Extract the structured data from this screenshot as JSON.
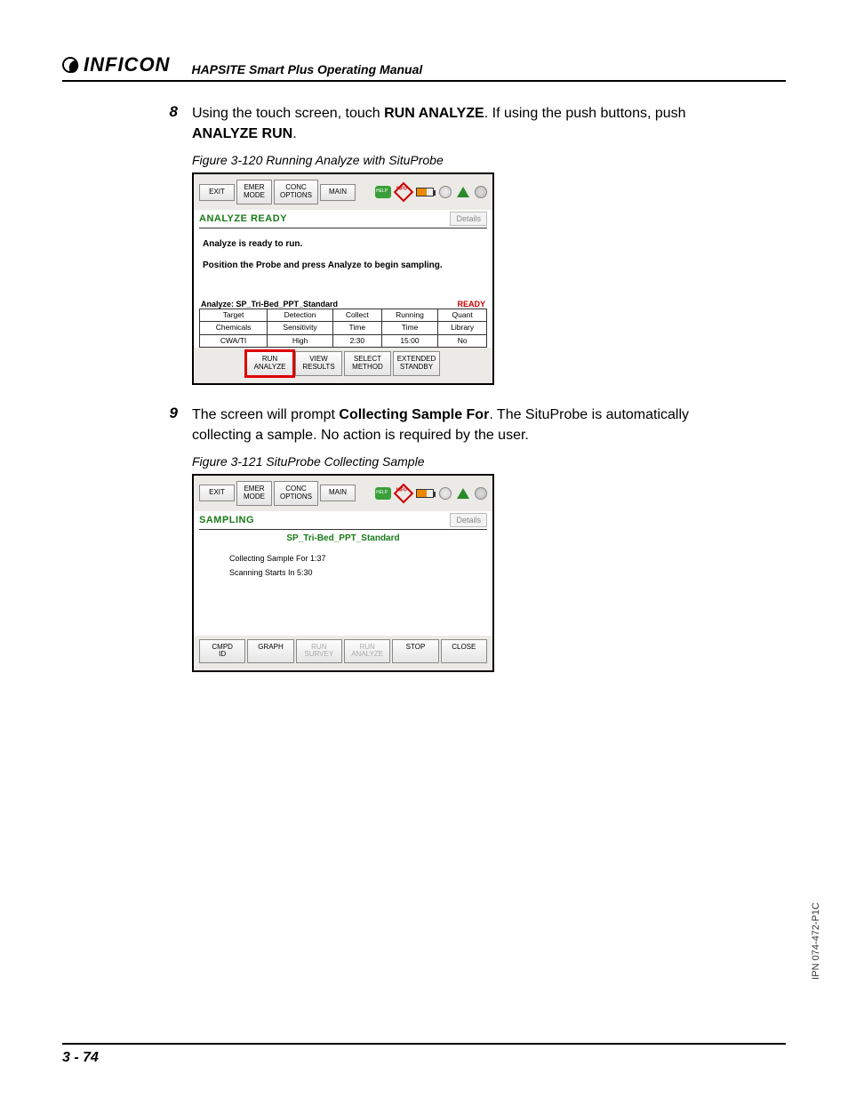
{
  "header": {
    "brand": "INFICON",
    "manual_title": "HAPSITE Smart Plus Operating Manual"
  },
  "step8": {
    "num": "8",
    "text_before": "Using the touch screen, touch ",
    "bold1": "RUN ANALYZE",
    "text_mid": ". If using the push buttons, push ",
    "bold2": "ANALYZE RUN",
    "text_after": "."
  },
  "fig120": {
    "caption": "Figure 3-120  Running Analyze with SituProbe",
    "toolbar": {
      "exit": "EXIT",
      "emer1": "EMER",
      "emer2": "MODE",
      "conc1": "CONC",
      "conc2": "OPTIONS",
      "main": "MAIN"
    },
    "status": "ANALYZE READY",
    "details": "Details",
    "msg1": "Analyze is ready to run.",
    "msg2": "Position the Probe and press Analyze to begin sampling.",
    "analyze_label": "Analyze: SP_Tri-Bed_PPT_Standard",
    "ready": "READY",
    "table": {
      "r1": [
        "Target",
        "Detection",
        "Collect",
        "Running",
        "Quant"
      ],
      "r2": [
        "Chemicals",
        "Sensitivity",
        "Time",
        "Time",
        "Library"
      ],
      "r3": [
        "CWA/TI",
        "High",
        "2:30",
        "15:00",
        "No"
      ]
    },
    "buttons": {
      "run1": "RUN",
      "run2": "ANALYZE",
      "view1": "VIEW",
      "view2": "RESULTS",
      "sel1": "SELECT",
      "sel2": "METHOD",
      "ext1": "EXTENDED",
      "ext2": "STANDBY"
    }
  },
  "step9": {
    "num": "9",
    "text_before": "The screen will prompt ",
    "bold1": "Collecting Sample For",
    "text_after1": ". The SituProbe is automatically collecting a sample. No action is required by the user."
  },
  "fig121": {
    "caption": "Figure 3-121  SituProbe Collecting Sample",
    "status": "SAMPLING",
    "details": "Details",
    "method": "SP_Tri-Bed_PPT_Standard",
    "line1": "Collecting Sample For  1:37",
    "line2": "Scanning Starts In  5:30",
    "buttons": {
      "cmpd1": "CMPD",
      "cmpd2": "ID",
      "graph": "GRAPH",
      "rsurv1": "RUN",
      "rsurv2": "SURVEY",
      "ranal1": "RUN",
      "ranal2": "ANALYZE",
      "stop": "STOP",
      "close": "CLOSE"
    }
  },
  "side_label": "IPN 074-472-P1C",
  "page_number": "3 - 74"
}
